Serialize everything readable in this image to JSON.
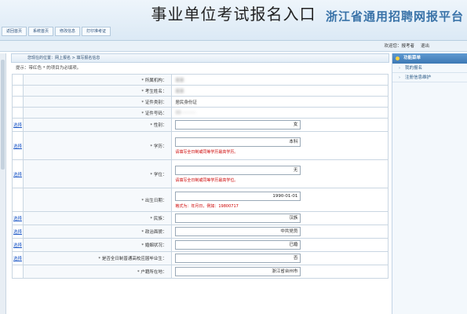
{
  "article_title": "事业单位考试报名入口",
  "header": {
    "nav_tabs": [
      "返回首页",
      "系统首页",
      "修改信息",
      "打印准考证"
    ],
    "brand": "浙江省通用招聘网报平台"
  },
  "userbar": {
    "welcome": "欢迎您：",
    "name": "报考者",
    "logout": "退出"
  },
  "breadcrumb": "您现在的位置：网上报名 > 填写报名信息",
  "tip": "提示：带红色 * 的项目为必填项。",
  "form": {
    "edit_label": "选择",
    "rows": [
      {
        "label": "* 所属机构：",
        "kind": "blur",
        "value": "某某"
      },
      {
        "label": "* 考生姓名：",
        "kind": "blur",
        "value": "某某"
      },
      {
        "label": "* 证件类别：",
        "kind": "static",
        "value": "居民身份证"
      },
      {
        "label": "* 证件号码：",
        "kind": "blur",
        "value": "33 ··········"
      },
      {
        "label": "* 性别：",
        "kind": "input",
        "value": "女",
        "link": true
      },
      {
        "label": "* 学历：",
        "kind": "input",
        "value": "本科",
        "link": true,
        "warn": "请填写全日制或同等学历最高学历。"
      },
      {
        "label": "* 学位：",
        "kind": "input",
        "value": "无",
        "link": true,
        "warn": "请填写全日制或同等学历最高学位。"
      },
      {
        "label": "* 出生日期：",
        "kind": "input",
        "value": "1990-01-01",
        "link": false,
        "note": "格式为：年月日，例如：19800717"
      },
      {
        "label": "* 民族：",
        "kind": "input",
        "value": "汉族",
        "link": true
      },
      {
        "label": "* 政治面貌：",
        "kind": "input",
        "value": "中共党员",
        "link": true
      },
      {
        "label": "* 婚姻状况：",
        "kind": "input",
        "value": "已婚",
        "link": true
      },
      {
        "label": "* 是否全日制普通高校应届毕业生：",
        "kind": "input",
        "value": "否",
        "link": true
      },
      {
        "label": "* 户籍所在地：",
        "kind": "input",
        "value": "浙江省台州市",
        "link": false
      }
    ]
  },
  "sidebar": {
    "head": "功能菜单",
    "items": [
      "我的报名",
      "注册信息维护"
    ]
  }
}
